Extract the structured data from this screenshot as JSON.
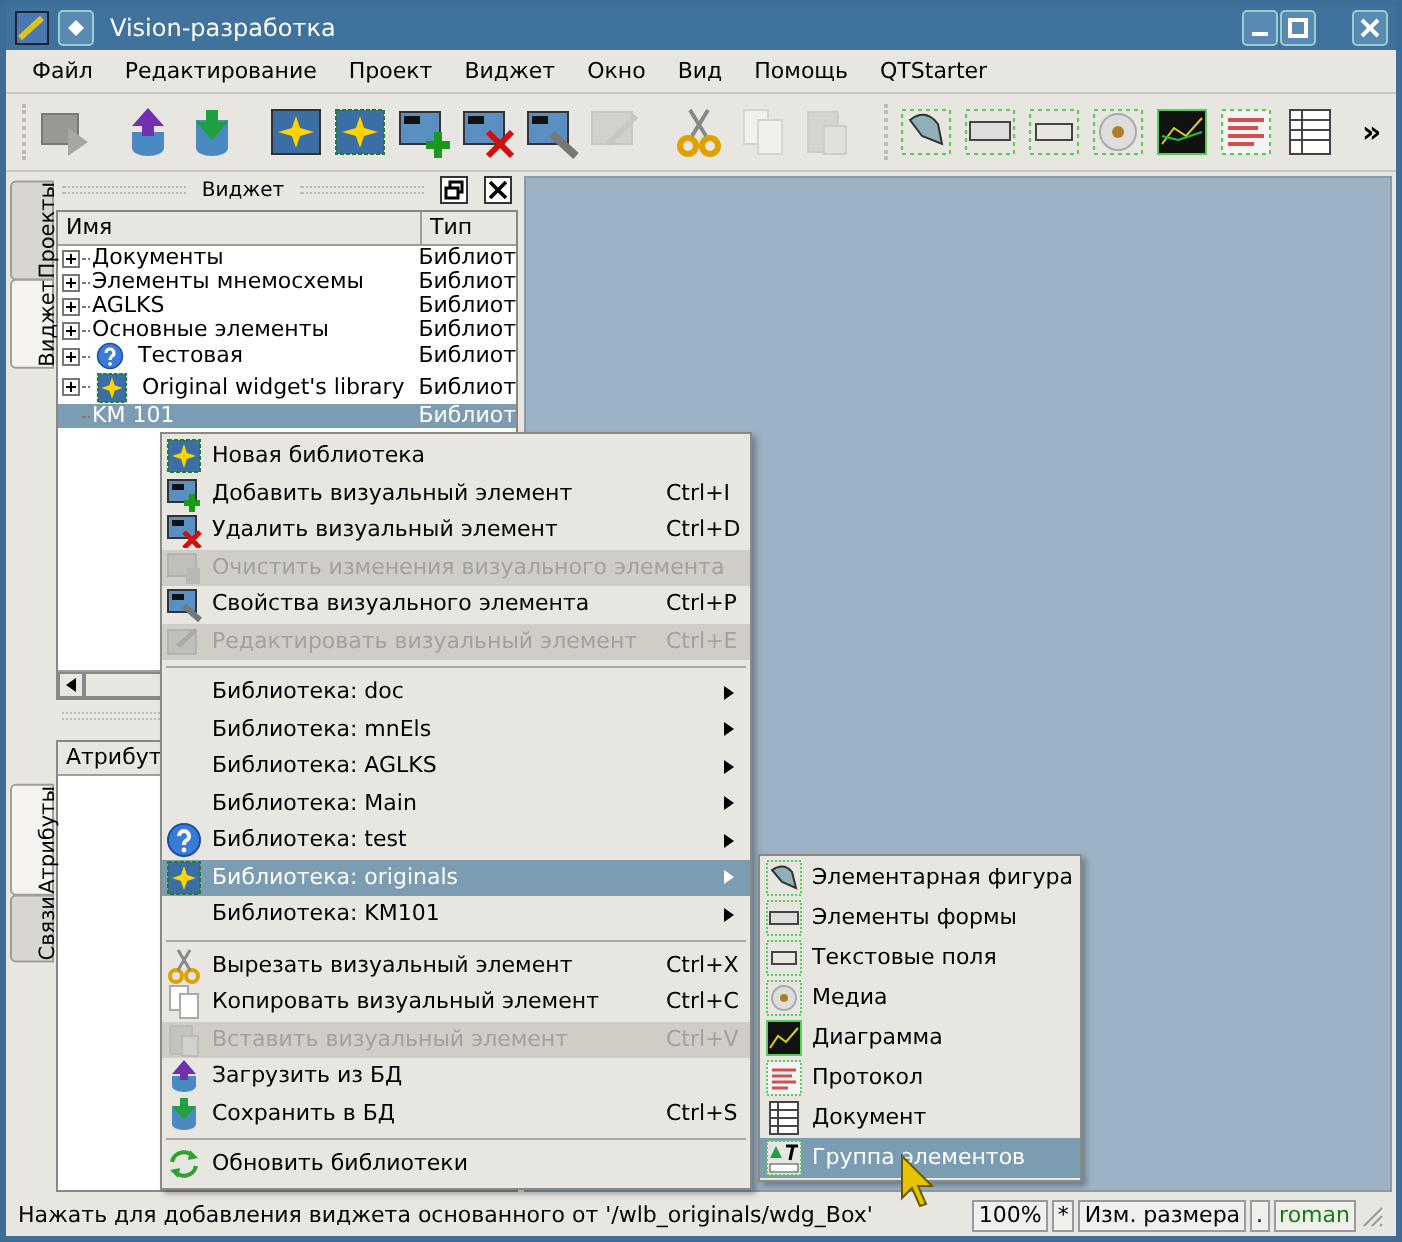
{
  "window": {
    "title": "Vision-разработка"
  },
  "menubar": [
    "Файл",
    "Редактирование",
    "Проект",
    "Виджет",
    "Окно",
    "Вид",
    "Помощь",
    "QTStarter"
  ],
  "toolbar": {
    "buttons": [
      {
        "disabled": false
      },
      {
        "disabled": false
      },
      {
        "disabled": false
      },
      {
        "disabled": false
      },
      {
        "disabled": false
      },
      {
        "disabled": false
      },
      {
        "disabled": false
      },
      {
        "disabled": false
      },
      {
        "disabled": true
      },
      {
        "disabled": false
      },
      {
        "disabled": true
      },
      {
        "disabled": true
      },
      {
        "disabled": false
      },
      {
        "disabled": false
      },
      {
        "disabled": false
      },
      {
        "disabled": false
      },
      {
        "disabled": false
      },
      {
        "disabled": false
      },
      {
        "disabled": false
      }
    ],
    "overflow": "»"
  },
  "side_tabs_top": [
    {
      "label": "Проекты",
      "selected": false
    },
    {
      "label": "Виджет",
      "selected": true
    }
  ],
  "side_tabs_bottom": [
    {
      "label": "Атрибуты",
      "selected": true
    },
    {
      "label": "Связи",
      "selected": false
    }
  ],
  "widget_dock": {
    "title": "Виджет",
    "columns": [
      "Имя",
      "Тип"
    ],
    "rows": [
      {
        "name": "Документы",
        "type": "Библиот",
        "expandable": true,
        "selected": false
      },
      {
        "name": "Элементы мнемосхемы",
        "type": "Библиот",
        "expandable": true,
        "selected": false
      },
      {
        "name": "AGLKS",
        "type": "Библиот",
        "expandable": true,
        "selected": false
      },
      {
        "name": "Основные элементы",
        "type": "Библиот",
        "expandable": true,
        "selected": false
      },
      {
        "name": "Тестовая",
        "type": "Библиот",
        "expandable": true,
        "selected": false
      },
      {
        "name": "Original widget's library",
        "type": "Библиот",
        "expandable": true,
        "selected": false
      },
      {
        "name": "KM 101",
        "type": "Библиот",
        "expandable": false,
        "selected": true
      }
    ]
  },
  "attributes_dock": {
    "columns": [
      "Атрибут"
    ]
  },
  "context_menu": [
    {
      "kind": "action",
      "label": "Новая библиотека",
      "disabled": false,
      "selected": false
    },
    {
      "kind": "action",
      "label": "Добавить визуальный элемент",
      "shortcut": "Ctrl+I",
      "disabled": false,
      "selected": false
    },
    {
      "kind": "action",
      "label": "Удалить визуальный элемент",
      "shortcut": "Ctrl+D",
      "disabled": false,
      "selected": false
    },
    {
      "kind": "action",
      "label": "Очистить изменения визуального элемента",
      "disabled": true,
      "selected": false
    },
    {
      "kind": "action",
      "label": "Свойства визуального элемента",
      "shortcut": "Ctrl+P",
      "disabled": false,
      "selected": false
    },
    {
      "kind": "action",
      "label": "Редактировать визуальный элемент",
      "shortcut": "Ctrl+E",
      "disabled": true,
      "selected": false
    },
    {
      "kind": "separator"
    },
    {
      "kind": "submenu",
      "label": "Библиотека: doc",
      "disabled": false,
      "selected": false
    },
    {
      "kind": "submenu",
      "label": "Библиотека: mnEls",
      "disabled": false,
      "selected": false
    },
    {
      "kind": "submenu",
      "label": "Библиотека: AGLKS",
      "disabled": false,
      "selected": false
    },
    {
      "kind": "submenu",
      "label": "Библиотека: Main",
      "disabled": false,
      "selected": false
    },
    {
      "kind": "submenu",
      "label": "Библиотека: test",
      "disabled": false,
      "selected": false
    },
    {
      "kind": "submenu",
      "label": "Библиотека: originals",
      "disabled": false,
      "selected": true
    },
    {
      "kind": "submenu",
      "label": "Библиотека: KM101",
      "disabled": false,
      "selected": false
    },
    {
      "kind": "separator"
    },
    {
      "kind": "action",
      "label": "Вырезать визуальный элемент",
      "shortcut": "Ctrl+X",
      "disabled": false,
      "selected": false
    },
    {
      "kind": "action",
      "label": "Копировать визуальный элемент",
      "shortcut": "Ctrl+C",
      "disabled": false,
      "selected": false
    },
    {
      "kind": "action",
      "label": "Вставить визуальный элемент",
      "shortcut": "Ctrl+V",
      "disabled": true,
      "selected": false
    },
    {
      "kind": "action",
      "label": "Загрузить из БД",
      "disabled": false,
      "selected": false
    },
    {
      "kind": "action",
      "label": "Сохранить в БД",
      "shortcut": "Ctrl+S",
      "disabled": false,
      "selected": false
    },
    {
      "kind": "separator"
    },
    {
      "kind": "action",
      "label": "Обновить библиотеки",
      "disabled": false,
      "selected": false
    }
  ],
  "submenu": [
    {
      "label": "Элементарная фигура",
      "selected": false
    },
    {
      "label": "Элементы формы",
      "selected": false
    },
    {
      "label": "Текстовые поля",
      "selected": false
    },
    {
      "label": "Медиа",
      "selected": false
    },
    {
      "label": "Диаграмма",
      "selected": false
    },
    {
      "label": "Протокол",
      "selected": false
    },
    {
      "label": "Документ",
      "selected": false
    },
    {
      "label": "Группа элементов",
      "selected": true
    }
  ],
  "status_bar": {
    "message": "Нажать для добавления виджета основанного от '/wlb_originals/wdg_Box'",
    "zoom": "100%",
    "modified": "*",
    "mode": "Изм. размера",
    "separator": ".",
    "user": "roman"
  }
}
